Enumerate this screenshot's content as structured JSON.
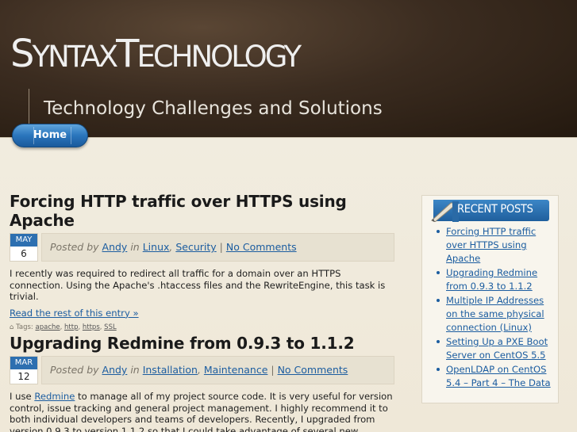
{
  "site": {
    "title_parts": [
      "S",
      "YNTAX",
      "T",
      "ECHNOLOGY"
    ],
    "tagline": "Technology Challenges and Solutions"
  },
  "nav": {
    "home": "Home"
  },
  "posts": [
    {
      "title": "Forcing HTTP traffic over HTTPS using Apache",
      "month": "May",
      "day": "6",
      "posted_by": "Posted by",
      "author": "Andy",
      "in": "in",
      "categories": [
        "Linux",
        "Security"
      ],
      "comments": "No Comments",
      "body": "I recently was required to redirect all traffic for a domain over an HTTPS connection. Using the Apache's .htaccess files and the RewriteEngine, this task is trivial.",
      "read_more": "Read the rest of this entry »",
      "tags_label": "Tags:",
      "tags": [
        "apache",
        "http",
        "https",
        "SSL"
      ]
    },
    {
      "title": "Upgrading Redmine from 0.9.3 to 1.1.2",
      "month": "Mar",
      "day": "12",
      "posted_by": "Posted by",
      "author": "Andy",
      "in": "in",
      "categories": [
        "Installation",
        "Maintenance"
      ],
      "comments": "No Comments",
      "body_pre": "I use ",
      "body_link": "Redmine",
      "body_post": " to manage all of my project source code. It is very useful for version control, issue tracking and general project management. I highly recommend it to both individual developers and teams of developers. Recently, I upgraded from version 0.9.3 to version 1.1.2 so that I could take advantage of several new features – specifically, the new API."
    }
  ],
  "sidebar": {
    "title": "Recent Posts",
    "items": [
      "Forcing HTTP traffic over HTTPS using Apache",
      "Upgrading Redmine from 0.9.3 to 1.1.2",
      "Multiple IP Addresses on the same physical connection (Linux)",
      "Setting Up a PXE Boot Server on CentOS 5.5",
      "OpenLDAP on CentOS 5.4 – Part 4 – The Data"
    ]
  },
  "colors": {
    "accent": "#2d6fb0",
    "link": "#1c5da0",
    "header_bg": "#3b2c20"
  }
}
